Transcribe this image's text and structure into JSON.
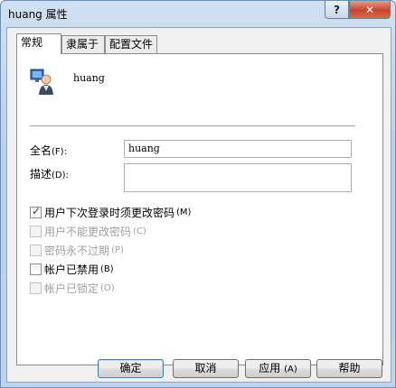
{
  "window": {
    "title": "huang 属性",
    "help_label": "?",
    "close_label": "✕"
  },
  "tabs": [
    {
      "label": "常规",
      "active": true
    },
    {
      "label": "隶属于",
      "active": false
    },
    {
      "label": "配置文件",
      "active": false
    }
  ],
  "general": {
    "username": "huang",
    "fullname": {
      "label": "全名",
      "accel": "(F):",
      "value": "huang"
    },
    "description": {
      "label": "描述",
      "accel": "(D):",
      "value": ""
    }
  },
  "options": [
    {
      "label": "用户下次登录时须更改密码",
      "accel": "(M)",
      "checked": true,
      "enabled": true
    },
    {
      "label": "用户不能更改密码",
      "accel": "(C)",
      "checked": false,
      "enabled": false
    },
    {
      "label": "密码永不过期",
      "accel": "(P)",
      "checked": false,
      "enabled": false
    },
    {
      "label": "帐户已禁用",
      "accel": "(B)",
      "checked": false,
      "enabled": true
    },
    {
      "label": "帐户已锁定",
      "accel": "(O)",
      "checked": false,
      "enabled": false
    }
  ],
  "buttons": {
    "ok": "确定",
    "cancel": "取消",
    "apply": "应用",
    "apply_accel": "(A)",
    "help": "帮助"
  },
  "icons": {
    "user": "user-icon",
    "help": "help-icon",
    "close": "close-icon"
  },
  "colors": {
    "title_glass": "#b9d1ea",
    "close_red": "#c8452d",
    "default_button_border": "#3c7fb1"
  }
}
